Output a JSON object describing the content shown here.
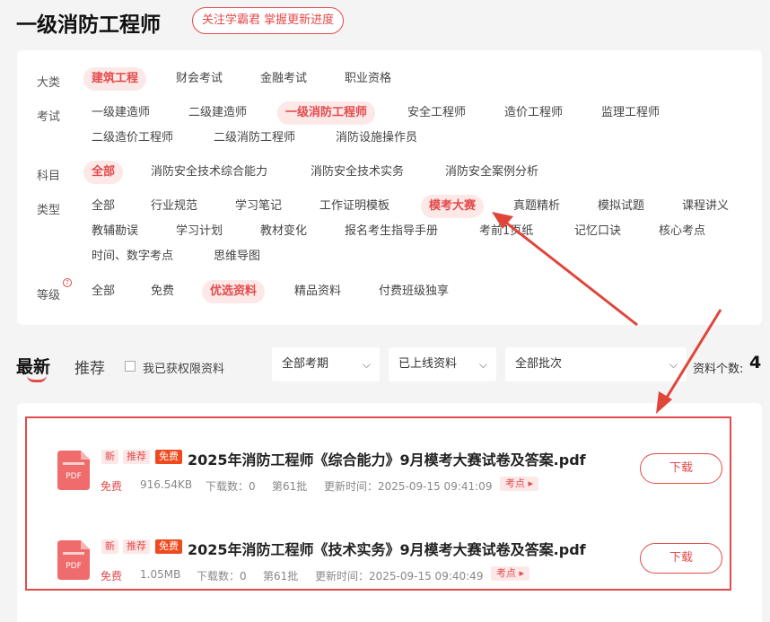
{
  "header": {
    "title": "一级消防工程师",
    "follow_label": "关注学霸君 掌握更新进度"
  },
  "filters": {
    "category": {
      "label": "大类",
      "items": [
        "建筑工程",
        "财会考试",
        "金融考试",
        "职业资格"
      ],
      "active": "建筑工程"
    },
    "exam": {
      "label": "考试",
      "items": [
        "一级建造师",
        "二级建造师",
        "一级消防工程师",
        "安全工程师",
        "造价工程师",
        "监理工程师",
        "二级造价工程师",
        "二级消防工程师",
        "消防设施操作员"
      ],
      "active": "一级消防工程师"
    },
    "subject": {
      "label": "科目",
      "items": [
        "全部",
        "消防安全技术综合能力",
        "消防安全技术实务",
        "消防安全案例分析"
      ],
      "active": "全部"
    },
    "type": {
      "label": "类型",
      "items": [
        "全部",
        "行业规范",
        "学习笔记",
        "工作证明模板",
        "模考大赛",
        "真题精析",
        "模拟试题",
        "课程讲义",
        "教辅勘误",
        "学习计划",
        "教材变化",
        "报名考生指导手册",
        "考前1页纸",
        "记忆口诀",
        "核心考点",
        "时间、数字考点",
        "思维导图"
      ],
      "active": "模考大赛"
    },
    "level": {
      "label": "等级",
      "hint_icon": "?",
      "items": [
        "全部",
        "免费",
        "优选资料",
        "精品资料",
        "付费班级独享"
      ],
      "active": "优选资料"
    }
  },
  "list_header": {
    "tab_latest": "最新",
    "tab_recommend": "推荐",
    "permission_checkbox_label": "我已获权限资料",
    "selects": [
      "全部考期",
      "已上线资料",
      "全部批次"
    ],
    "count_label": "资料个数:",
    "count_value": "4"
  },
  "files": [
    {
      "badge_new": "新",
      "badge_recommend": "推荐",
      "badge_free": "免费",
      "title": "2025年消防工程师《综合能力》9月模考大赛试卷及答案.pdf",
      "price": "免费",
      "size": "916.54KB",
      "downloads": "下载数：0",
      "batch": "第61批",
      "updated": "更新时间：2025-09-15 09:41:09",
      "tag": "考点",
      "download_label": "下载",
      "icon_label": "PDF"
    },
    {
      "badge_new": "新",
      "badge_recommend": "推荐",
      "badge_free": "免费",
      "title": "2025年消防工程师《技术实务》9月模考大赛试卷及答案.pdf",
      "price": "免费",
      "size": "1.05MB",
      "downloads": "下载数：0",
      "batch": "第61批",
      "updated": "更新时间：2025-09-15 09:40:49",
      "tag": "考点",
      "download_label": "下载",
      "icon_label": "PDF"
    }
  ],
  "colors": {
    "accent": "#e34a4a",
    "badge_free": "#ee4a1e",
    "annotation": "#e0453a"
  },
  "icons": {
    "chevron": "chevron-down-icon",
    "file": "pdf-file-icon",
    "tag_arrow": "triangle-right-icon"
  }
}
